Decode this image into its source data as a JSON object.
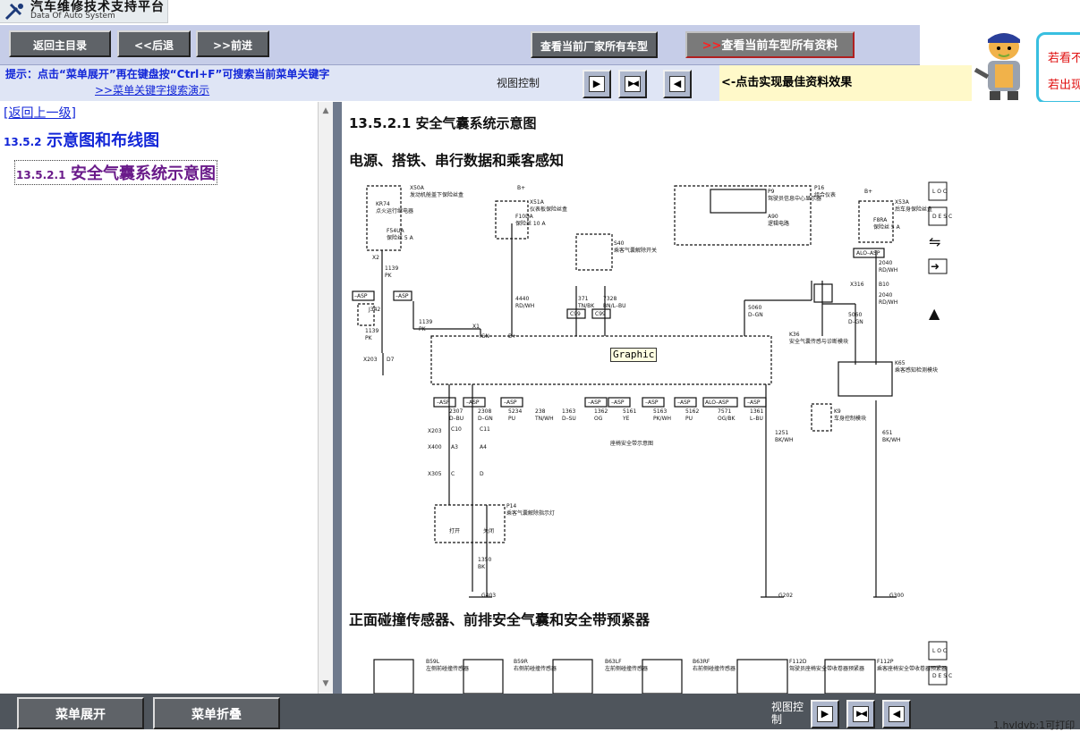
{
  "logo": {
    "title": "汽车维修技术支持平台",
    "subtitle": "Data Of Auto System"
  },
  "nav": {
    "home": "返回主目录",
    "back": "<<后退",
    "forward": ">>前进",
    "maker_models": "查看当前厂家所有车型",
    "model_all_arrow": ">>",
    "model_all": "查看当前车型所有资料"
  },
  "hint": {
    "line1": "提示：点击“菜单展开”再在键盘按“Ctrl+F”可搜索当前菜单关键字",
    "line2": ">>菜单关键字搜索演示"
  },
  "view_control": {
    "label": "视图控制",
    "best_effect": "<-点击实现最佳资料效果"
  },
  "side_promo": {
    "line1": "若看不",
    "line2": "若出现"
  },
  "left": {
    "back_link": "[返回上一级]",
    "section_num": "13.5.2",
    "section_title": "示意图和布线图",
    "subsection_num": "13.5.2.1",
    "subsection_title": "安全气囊系统示意图"
  },
  "content": {
    "page_title": "13.5.2.1 安全气囊系统示意图",
    "heading1": "电源、搭铁、串行数据和乘客感知",
    "heading2": "正面碰撞传感器、前排安全气囊和安全带预紧器",
    "tooltip": "Graphic"
  },
  "diagram": {
    "labels": {
      "x50a": "X50A",
      "x50a_desc": "发动机舱盖下保险丝盒",
      "kr74": "KR74",
      "kr74_desc": "点火运行继电器",
      "f54ua": "F54UA",
      "f54ua_desc": "保险丝 5 A",
      "x51a": "X51A",
      "x51a_desc": "仪表板保险丝盒",
      "f10da": "F10DA",
      "f10da_desc": "保险丝 10 A",
      "s40": "S40",
      "s40_desc": "乘客气囊解除开关",
      "p16": "P16",
      "p16_desc": "组合仪表",
      "p9": "P9",
      "p9_desc": "驾驶员信息中心显示器",
      "a90": "A90",
      "a90_desc": "逻辑电路",
      "x53a": "X53A",
      "x53a_desc": "后车身保险丝盒",
      "f8ra": "F8RA",
      "f8ra_desc": "保险丝 5 A",
      "k36": "K36",
      "k36_desc": "安全气囊传感与诊断模块",
      "k65": "K65",
      "k65_desc": "乘客感知检测模块",
      "k9": "K9",
      "k9_desc": "车身控制模块",
      "p14": "P14",
      "p14_desc": "乘客气囊解除指示灯",
      "p14_on": "打开",
      "p14_off": "关闭",
      "seatbelt": "座椅安全带示意图",
      "bplus": "B+",
      "ign": "IGN",
      "alo_asp": "ALO–ASP",
      "asp": "–ASP",
      "c99": "C99",
      "x2": "X2",
      "x1": "X1",
      "x203": "X203",
      "x400": "X400",
      "x305": "X305",
      "x316": "X316",
      "j342": "J342",
      "d7": "D7",
      "b10": "B10",
      "g403": "G403",
      "g202": "G202",
      "g300": "G300",
      "w1139": "1139",
      "pk": "PK",
      "w4440": "4440",
      "rdwh": "RD/WH",
      "w371": "371",
      "tnbk": "TN/BK",
      "w7328": "7328",
      "bnlbu": "BN/L–BU",
      "w5060": "5060",
      "dgn": "D–GN",
      "w2040": "2040",
      "w1251": "1251",
      "bkwh": "BK/WH",
      "w651": "651",
      "w2307": "2307",
      "dbu": "D–BU",
      "w2308": "2308",
      "w1350": "1350",
      "bk": "BK",
      "c10": "C10",
      "c11": "C11",
      "a3": "A3",
      "a4": "A4",
      "c": "C",
      "d": "D",
      "w5234": "5234",
      "pu": "PU",
      "w238": "238",
      "tnwh": "TN/WH",
      "w1363": "1363",
      "dsu": "D–SU",
      "w1362": "1362",
      "og": "OG",
      "w5161": "5161",
      "ye": "YE",
      "w5163": "5163",
      "pkwh": "PK/WH",
      "w5162": "5162",
      "w7571": "7571",
      "ogbk": "OG/BK",
      "w1361": "1361",
      "lbu": "L–BU",
      "b59l": "B59L",
      "b59l_desc": "左侧前碰撞传感器",
      "b59r": "B59R",
      "b59r_desc": "右侧前碰撞传感器",
      "b63lf": "B63LF",
      "b63lf_desc": "左前侧碰撞传感器",
      "b63rf": "B63RF",
      "b63rf_desc": "右前侧碰撞传感器",
      "f112d": "F112D",
      "f112d_desc": "驾驶员座椅安全带收卷器预紧器",
      "f112p": "F112P",
      "f112p_desc": "乘客座椅安全带收卷器预紧器",
      "loc": "L O C",
      "desc": "D E S C"
    }
  },
  "bottom": {
    "expand": "菜单展开",
    "collapse": "菜单折叠",
    "view_label": "视图控制",
    "footnote": "1.hvldvb:1可打印"
  }
}
